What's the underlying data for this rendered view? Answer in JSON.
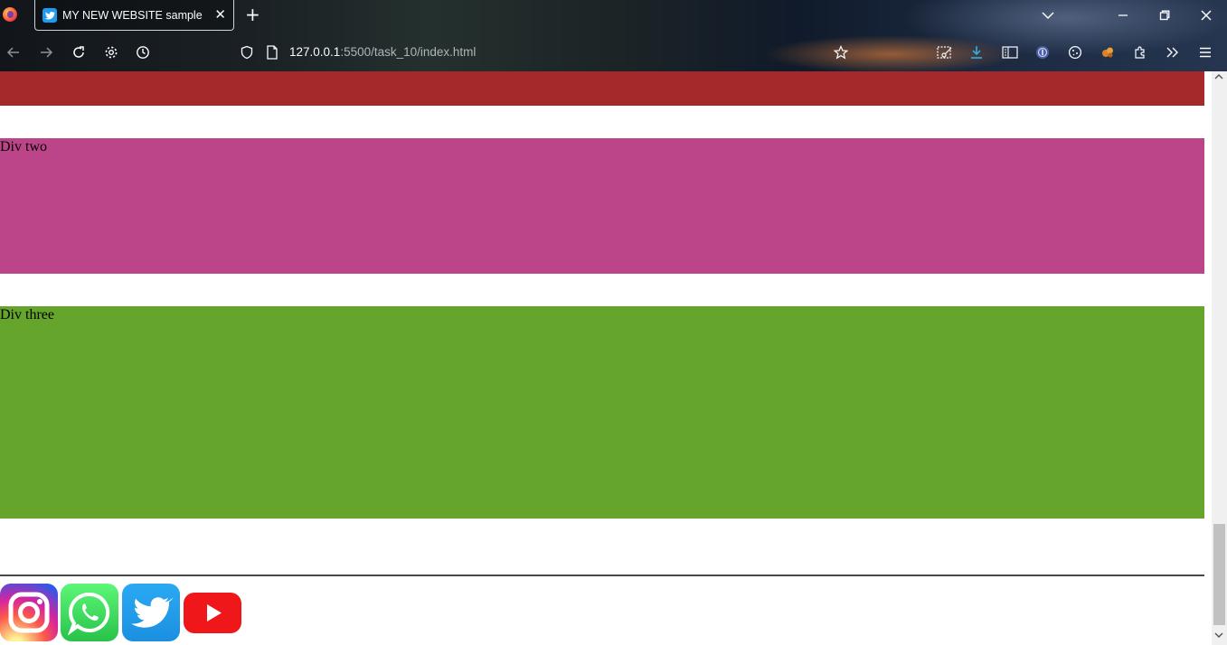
{
  "browser": {
    "tab_title": "MY NEW WEBSITE sample",
    "tab_close": "✕",
    "new_tab": "+",
    "url_host": "127.0.0.1",
    "url_path": ":5500/task_10/index.html"
  },
  "page": {
    "block_two_label": "Div two",
    "block_three_label": "Div three",
    "colors": {
      "block_one": "#a5282a",
      "block_two": "#bc4589",
      "block_three": "#65a52b"
    },
    "social_icons": [
      "instagram-icon",
      "whatsapp-icon",
      "twitter-icon",
      "youtube-icon"
    ]
  }
}
